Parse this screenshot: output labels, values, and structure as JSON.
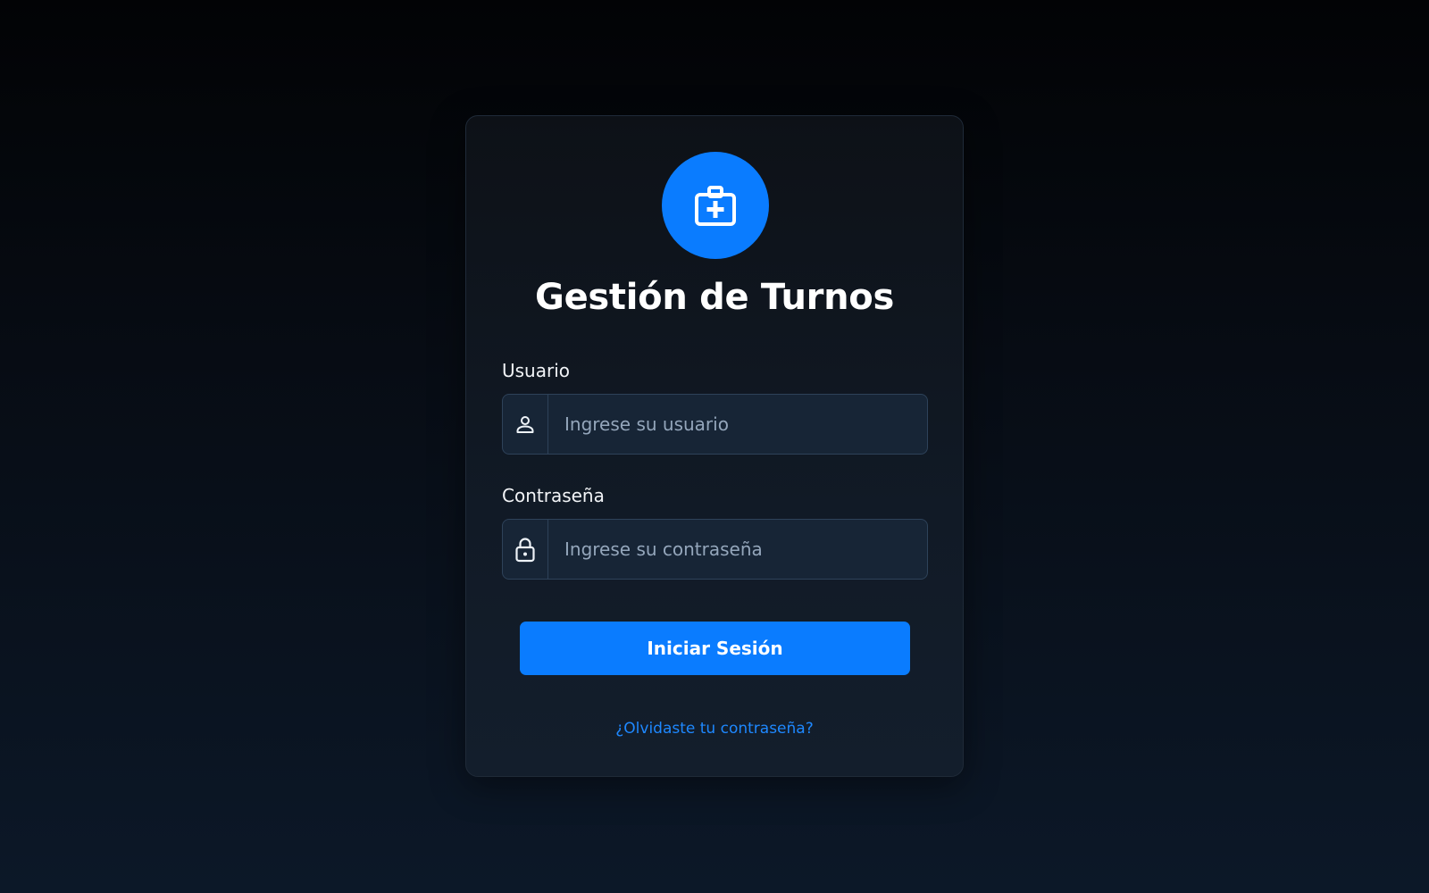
{
  "app": {
    "title": "Gestión de Turnos",
    "logo_icon": "medical-kit-icon",
    "accent_color": "#0a7cff"
  },
  "form": {
    "username": {
      "label": "Usuario",
      "placeholder": "Ingrese su usuario",
      "value": "",
      "icon": "user-icon"
    },
    "password": {
      "label": "Contraseña",
      "placeholder": "Ingrese su contraseña",
      "value": "",
      "icon": "lock-icon"
    },
    "submit_label": "Iniciar Sesión",
    "forgot_label": "¿Olvidaste tu contraseña?"
  }
}
